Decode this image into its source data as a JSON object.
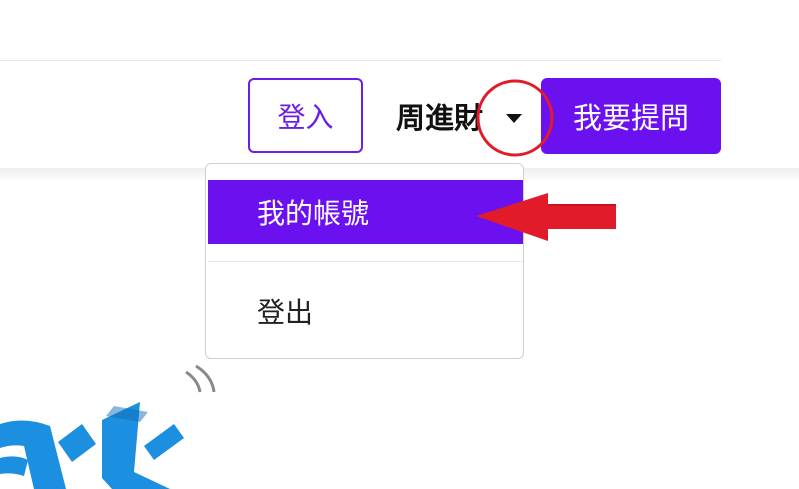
{
  "header": {
    "login_label": "登入",
    "user_name": "周進財",
    "ask_label": "我要提問"
  },
  "dropdown": {
    "items": [
      {
        "label": "我的帳號",
        "state": "active"
      },
      {
        "label": "登出",
        "state": "normal"
      }
    ]
  },
  "annotations": {
    "circle_color": "#e21b2a",
    "arrow_color": "#e21b2a"
  },
  "colors": {
    "accent": "#6b10ee",
    "logo_blue": "#1d8fe0"
  },
  "icons": {
    "caret": "caret-down-icon"
  }
}
